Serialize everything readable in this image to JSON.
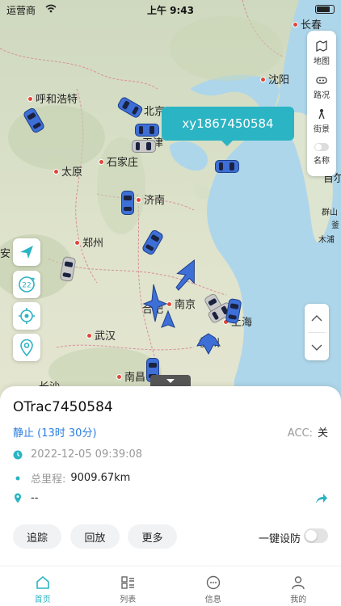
{
  "status_bar": {
    "carrier": "运营商",
    "time": "上午 9:43"
  },
  "map": {
    "cities": [
      "长春",
      "沈阳",
      "呼和浩特",
      "北京",
      "天津",
      "石家庄",
      "太原",
      "济南",
      "郑州",
      "南京",
      "合肥",
      "武汉",
      "杭州",
      "上海",
      "南昌",
      "长沙",
      "首尔",
      "群山",
      "木浦",
      "釜",
      "安"
    ],
    "tools": [
      {
        "label": "地图",
        "icon": "map-icon"
      },
      {
        "label": "路况",
        "icon": "traffic-icon"
      },
      {
        "label": "街景",
        "icon": "street-view-icon"
      },
      {
        "label": "名称",
        "icon": "name-toggle-icon"
      }
    ],
    "tooltip": "xy1867450584"
  },
  "device": {
    "name": "OTrac7450584",
    "status": "静止",
    "duration": "(13时 30分)",
    "acc_label": "ACC:",
    "acc_value": "关",
    "time": "2022-12-05 09:39:08",
    "mileage_label": "总里程:",
    "mileage_value": "9009.67km",
    "address": "--"
  },
  "actions": {
    "track": "追踪",
    "playback": "回放",
    "more": "更多",
    "defense": "一键设防"
  },
  "tabs": [
    {
      "label": "首页",
      "icon": "home-icon",
      "active": true
    },
    {
      "label": "列表",
      "icon": "list-icon",
      "active": false
    },
    {
      "label": "信息",
      "icon": "message-icon",
      "active": false
    },
    {
      "label": "我的",
      "icon": "profile-icon",
      "active": false
    }
  ],
  "colors": {
    "accent": "#2bb4c4",
    "status_blue": "#2a7de1",
    "car_blue": "#3d6fd6"
  }
}
